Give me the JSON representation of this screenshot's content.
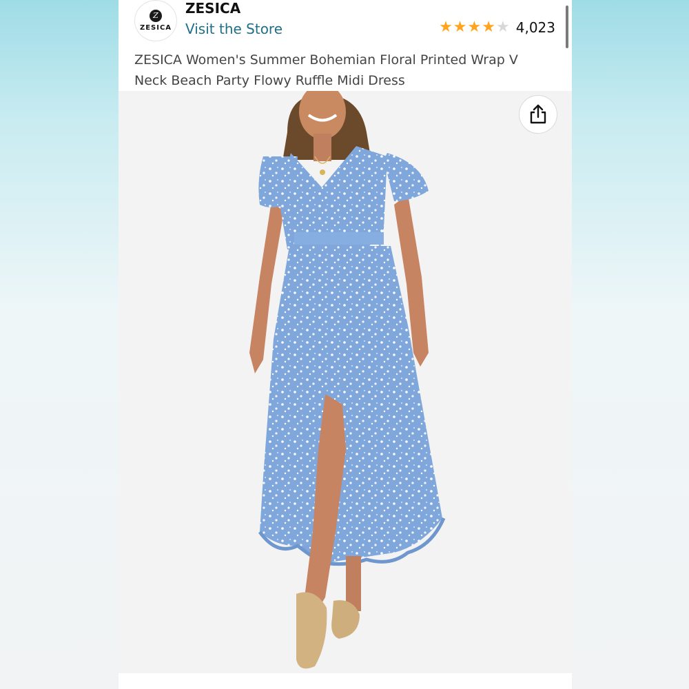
{
  "store": {
    "logo_text": "ZESICA",
    "brand_name": "ZESICA",
    "visit_link": "Visit the Store"
  },
  "rating": {
    "stars": 4.0,
    "stars_max": 5,
    "review_count": "4,023"
  },
  "product": {
    "title": "ZESICA Women's Summer Bohemian Floral Printed Wrap V Neck Beach Party Flowy Ruffle Midi Dress",
    "image_description_icon": "product-photo-blue-floral-wrap-dress"
  },
  "colors": {
    "link": "#1f6f85",
    "star": "#ffa41c",
    "dress": "#7fa7dc"
  },
  "icons": {
    "share": "share-icon"
  }
}
